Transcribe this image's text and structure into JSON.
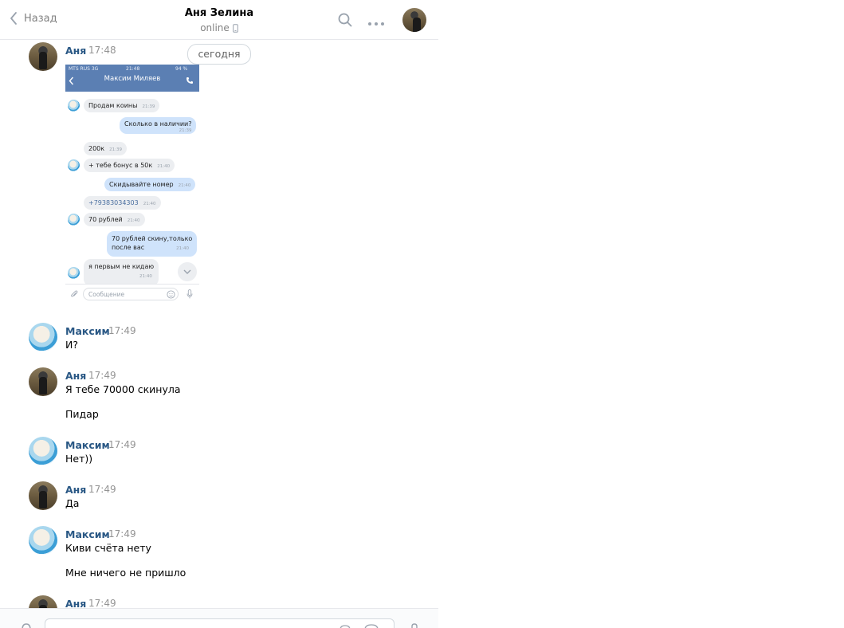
{
  "header": {
    "back_label": "Назад",
    "title": "Аня Зелина",
    "status": "online"
  },
  "date_pill": "сегодня",
  "screenshot": {
    "status_carrier": "MTS RUS  3G",
    "status_time": "21:48",
    "status_battery": "94 %",
    "contact_name": "Максим Миляев",
    "bubbles": [
      {
        "text": "Продам коины",
        "time": "21:39",
        "dir": "in"
      },
      {
        "text": "Сколько в наличии?",
        "time": "21:39",
        "dir": "out"
      },
      {
        "text": "200к",
        "time": "21:39",
        "dir": "in"
      },
      {
        "text": "+ тебе бонус в 50к",
        "time": "21:40",
        "dir": "in"
      },
      {
        "text": "Скидывайте номер",
        "time": "21:40",
        "dir": "out"
      },
      {
        "text": "+79383034303",
        "time": "21:40",
        "dir": "in"
      },
      {
        "text": "70 рублей",
        "time": "21:40",
        "dir": "in"
      },
      {
        "text": "70 рублей скину,только",
        "text2": "после вас",
        "time": "21:40",
        "dir": "out"
      },
      {
        "text": "я первым не кидаю",
        "time": "21:40",
        "dir": "in"
      }
    ],
    "input_placeholder": "Сообщение"
  },
  "messages": [
    {
      "name": "Аня",
      "time": "17:48"
    },
    {
      "name": "Максим",
      "time": "17:49",
      "lines": [
        "И?"
      ]
    },
    {
      "name": "Аня",
      "time": "17:49",
      "lines": [
        "Я тебе 70000 скинула",
        "Пидар"
      ]
    },
    {
      "name": "Максим",
      "time": "17:49",
      "lines": [
        "Нет))"
      ]
    },
    {
      "name": "Аня",
      "time": "17:49",
      "lines": [
        "Да"
      ]
    },
    {
      "name": "Максим",
      "time": "17:49",
      "lines": [
        "Киви счёта нету",
        "Мне ничего не пришло"
      ]
    },
    {
      "name": "Аня",
      "time": "17:49"
    }
  ],
  "colors": {
    "name_link": "#2a5885",
    "muted": "#939393",
    "header_bar_in_screenshot": "#5b7fb3"
  }
}
